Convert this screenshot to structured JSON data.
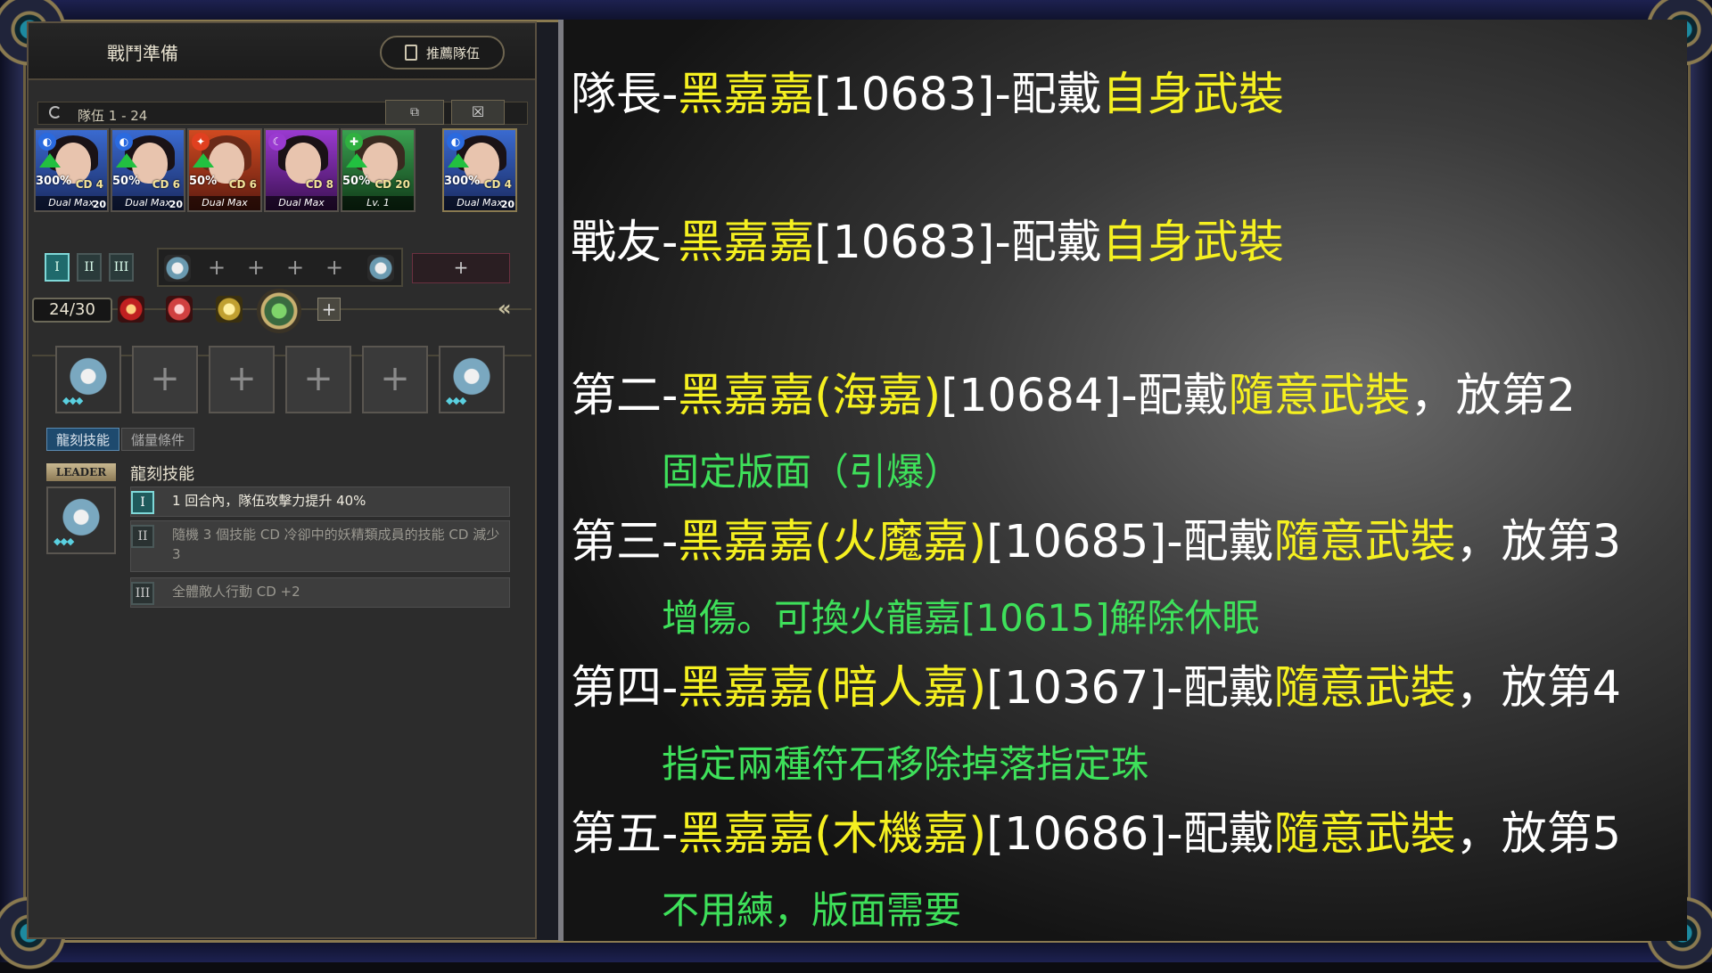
{
  "left_panel": {
    "title": "戰鬥準備",
    "recommend_button": "推薦隊伍",
    "team_label": "隊伍 1 - 24",
    "cards": [
      {
        "pct": "300%",
        "cd": "CD 4",
        "lvl": "Dual Max",
        "lvnum": "20",
        "attr_color": "#2a6adf"
      },
      {
        "pct": "50%",
        "cd": "CD 6",
        "lvl": "Dual Max",
        "lvnum": "20",
        "attr_color": "#2a6adf"
      },
      {
        "pct": "50%",
        "cd": "CD 6",
        "lvl": "Dual Max",
        "lvnum": "",
        "attr_color": "#e04020"
      },
      {
        "pct": "",
        "cd": "CD 8",
        "lvl": "Dual Max",
        "lvnum": "",
        "attr_color": "#9a3ad0"
      },
      {
        "pct": "50%",
        "cd": "CD 20",
        "lvl": "Lv. 1",
        "lvnum": "",
        "attr_color": "#30b040"
      },
      {
        "pct": "300%",
        "cd": "CD 4",
        "lvl": "Dual Max",
        "lvnum": "20",
        "attr_color": "#2a6adf"
      }
    ],
    "team_tabs": [
      "I",
      "II",
      "III"
    ],
    "count": "24/30",
    "skill_tabs": {
      "active": "龍刻技能",
      "inactive": "儲量條件"
    },
    "leader_tag": "LEADER",
    "skill_title": "龍刻技能",
    "skills": [
      {
        "num": "I",
        "text": "1 回合內，隊伍攻擊力提升 40%"
      },
      {
        "num": "II",
        "text": "隨機 3 個技能 CD 冷卻中的妖精類成員的技能 CD 減少 3"
      },
      {
        "num": "III",
        "text": "全體敵人行動 CD +2"
      }
    ]
  },
  "guide": {
    "line1": {
      "a": "隊長-",
      "b": "黑嘉嘉",
      "c": "[10683]-配戴",
      "d": "自身武裝"
    },
    "line2": {
      "a": "戰友-",
      "b": "黑嘉嘉",
      "c": "[10683]-配戴",
      "d": "自身武裝"
    },
    "line3": {
      "a": "第二-",
      "b": "黑嘉嘉(海嘉)",
      "c": "[10684]-配戴",
      "d": "隨意武裝",
      "e": "，放第2"
    },
    "note3": "固定版面（引爆）",
    "line4": {
      "a": "第三-",
      "b": "黑嘉嘉(火魔嘉)",
      "c": "[10685]-配戴",
      "d": "隨意武裝",
      "e": "，放第3"
    },
    "note4": "增傷。可換火龍嘉[10615]解除休眠",
    "line5": {
      "a": "第四-",
      "b": "黑嘉嘉(暗人嘉)",
      "c": "[10367]-配戴",
      "d": "隨意武裝",
      "e": "，放第4"
    },
    "note5": "指定兩種符石移除掉落指定珠",
    "line6": {
      "a": "第五-",
      "b": "黑嘉嘉(木機嘉)",
      "c": "[10686]-配戴",
      "d": "隨意武裝",
      "e": "，放第5"
    },
    "note6": "不用練，版面需要"
  }
}
